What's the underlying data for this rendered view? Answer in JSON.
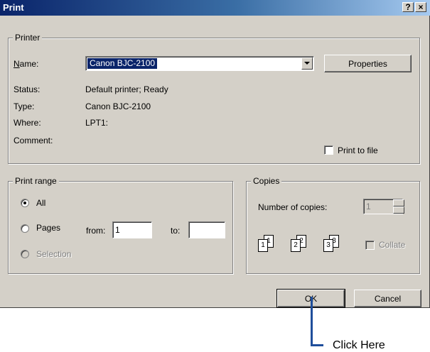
{
  "window": {
    "title": "Print",
    "help_label": "?",
    "close_label": "×"
  },
  "printer": {
    "group_label": "Printer",
    "name_label": "Name:",
    "name_value": "Canon BJC-2100",
    "properties_label": "Properties",
    "status_label": "Status:",
    "status_value": "Default printer; Ready",
    "type_label": "Type:",
    "type_value": "Canon BJC-2100",
    "where_label": "Where:",
    "where_value": "LPT1:",
    "comment_label": "Comment:",
    "comment_value": "",
    "print_to_file_label": "Print to file",
    "print_to_file_checked": false
  },
  "print_range": {
    "group_label": "Print range",
    "all_label": "All",
    "pages_label": "Pages",
    "from_label": "from:",
    "from_value": "1",
    "to_label": "to:",
    "to_value": "",
    "selection_label": "Selection",
    "selected": "All"
  },
  "copies": {
    "group_label": "Copies",
    "number_label": "Number of copies:",
    "number_value": "1",
    "collate_label": "Collate",
    "collate_checked": false,
    "page_labels": [
      "1",
      "1",
      "2",
      "2",
      "3",
      "3"
    ]
  },
  "buttons": {
    "ok_label": "OK",
    "cancel_label": "Cancel"
  },
  "annotation": {
    "text": "Click Here",
    "color": "#1f4e9b"
  }
}
